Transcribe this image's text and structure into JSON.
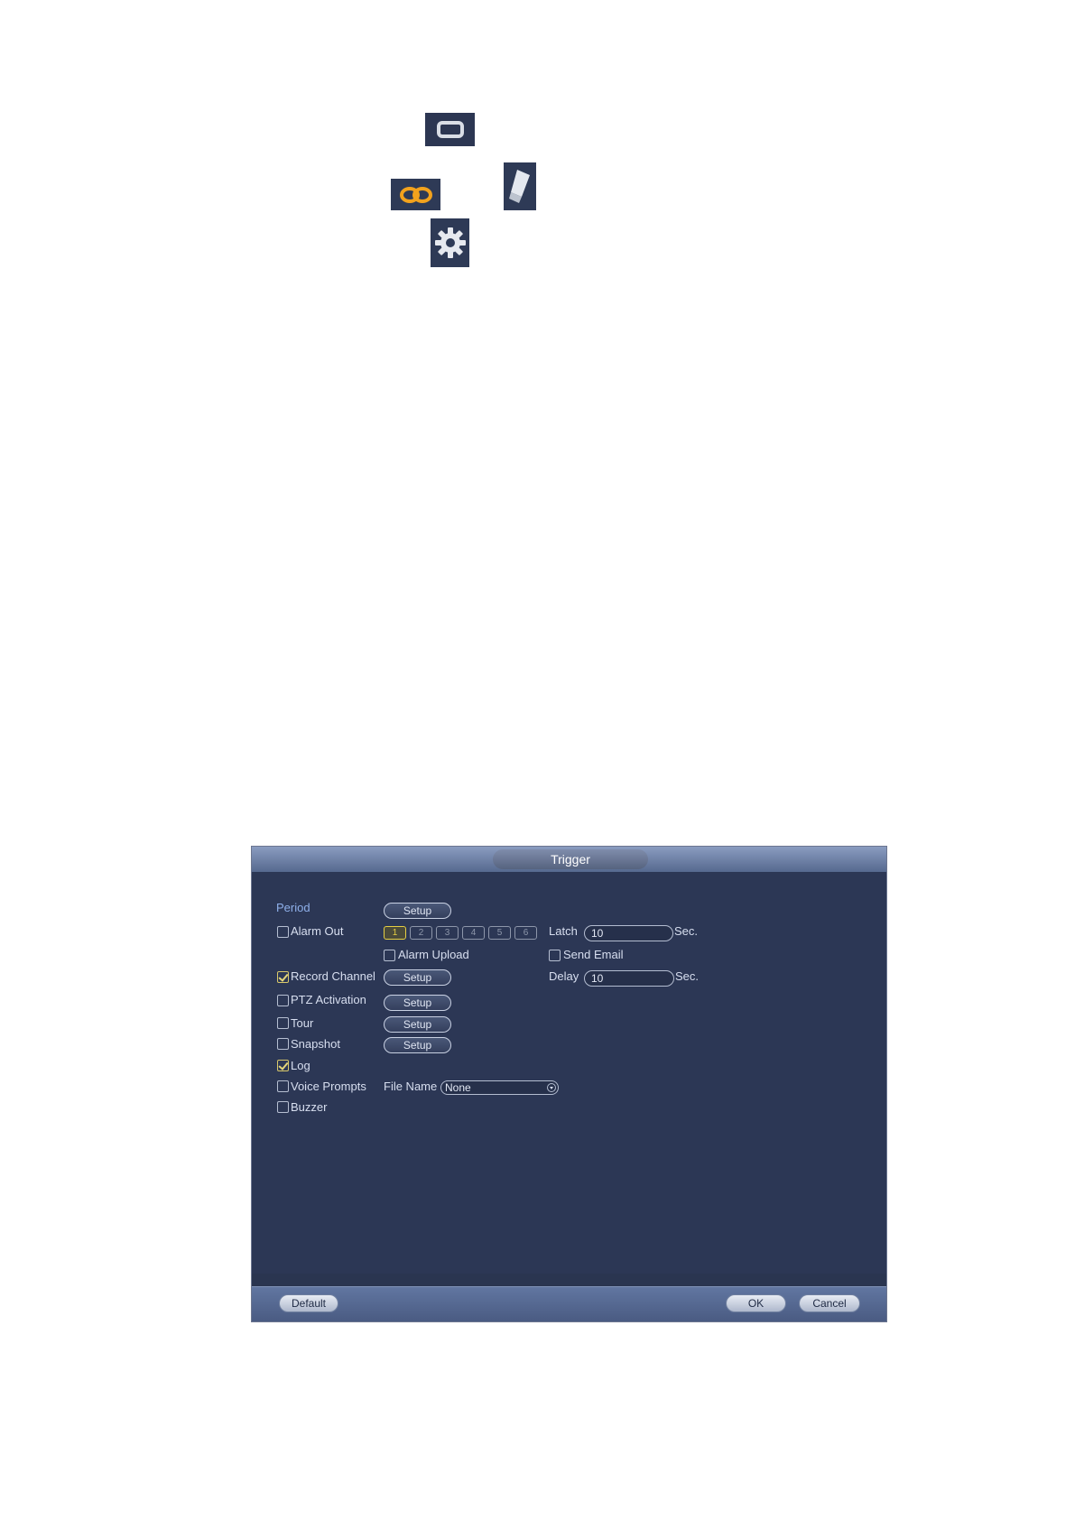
{
  "icons": {
    "window_icon": "window-icon",
    "link_icon": "link-icon",
    "eraser_icon": "eraser-icon",
    "gear_icon": "gear-icon"
  },
  "dialog": {
    "title": "Trigger",
    "period_label": "Period",
    "setup_label": "Setup",
    "alarm_out_label": "Alarm Out",
    "alarm_out_channels": [
      "1",
      "2",
      "3",
      "4",
      "5",
      "6"
    ],
    "latch_label": "Latch",
    "latch_value": "10",
    "sec_label": "Sec.",
    "alarm_upload_label": "Alarm Upload",
    "send_email_label": "Send Email",
    "record_channel_label": "Record Channel",
    "delay_label": "Delay",
    "delay_value": "10",
    "ptz_activation_label": "PTZ Activation",
    "tour_label": "Tour",
    "snapshot_label": "Snapshot",
    "log_label": "Log",
    "voice_prompts_label": "Voice Prompts",
    "file_name_label": "File Name",
    "file_name_value": "None",
    "buzzer_label": "Buzzer",
    "default_label": "Default",
    "ok_label": "OK",
    "cancel_label": "Cancel",
    "checked": {
      "alarm_out": false,
      "alarm_upload": false,
      "send_email": false,
      "record_channel": true,
      "ptz_activation": false,
      "tour": false,
      "snapshot": false,
      "log": true,
      "voice_prompts": false,
      "buzzer": false
    }
  }
}
